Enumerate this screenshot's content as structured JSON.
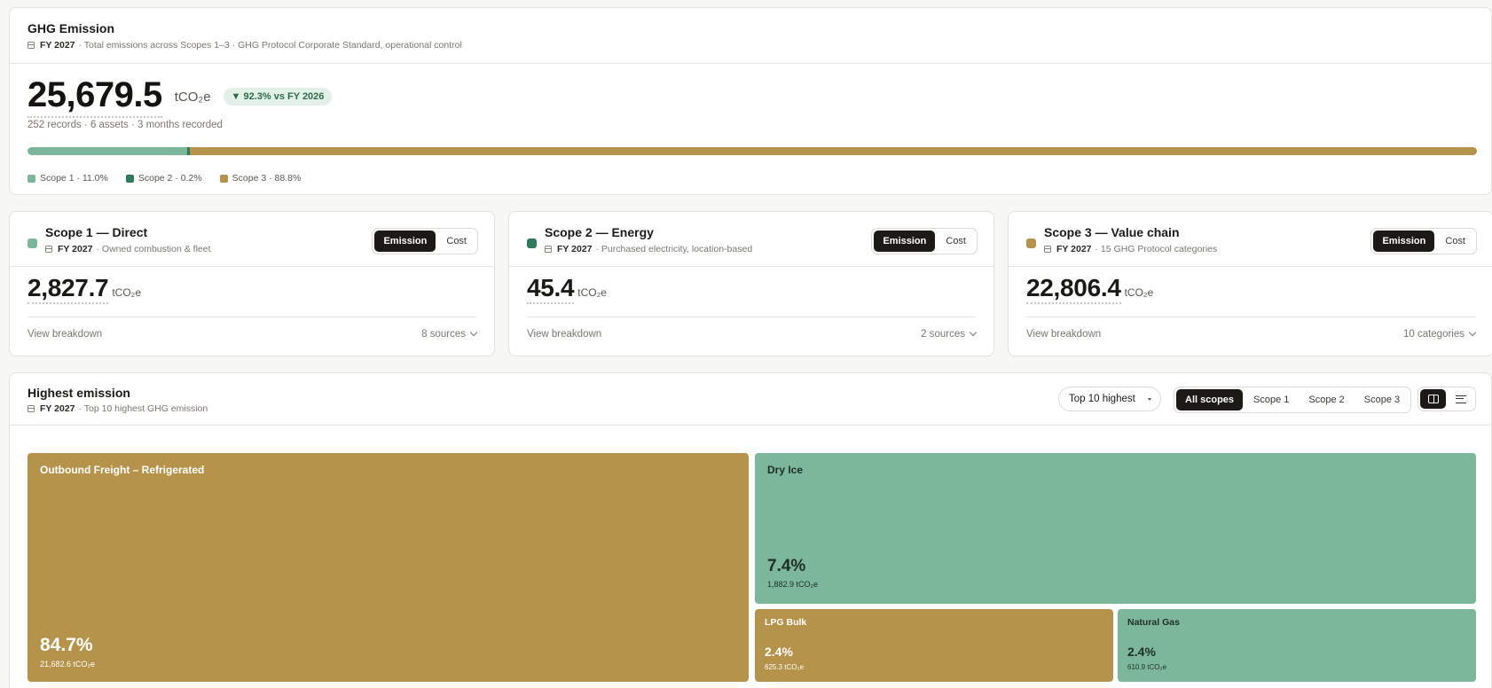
{
  "colors": {
    "scope1": "#7db79b",
    "scope2": "#2f7a5a",
    "scope3": "#b6934a"
  },
  "ghg": {
    "title": "GHG Emission",
    "fy": "FY 2027",
    "description": "· Total emissions across Scopes 1–3 · GHG Protocol Corporate Standard, operational control",
    "total": "25,679.5",
    "unit": "tCO₂e",
    "change_badge": "▼ 92.3% vs FY 2026",
    "summary": "252 records · 6 assets · 3 months recorded",
    "share_pct": [
      11.0,
      0.2,
      88.8
    ],
    "legend": [
      "Scope 1 · 11.0%",
      "Scope 2 · 0.2%",
      "Scope 3 · 88.8%"
    ]
  },
  "scopes": [
    {
      "title": "Scope 1 — Direct",
      "fy": "FY 2027",
      "description": "· Owned combustion & fleet",
      "value": "2,827.7",
      "unit": "tCO₂e",
      "toggle": [
        "Emission",
        "Cost"
      ],
      "breakdown": "View breakdown",
      "count": "8 sources"
    },
    {
      "title": "Scope 2 — Energy",
      "fy": "FY 2027",
      "description": "· Purchased electricity, location-based",
      "value": "45.4",
      "unit": "tCO₂e",
      "toggle": [
        "Emission",
        "Cost"
      ],
      "breakdown": "View breakdown",
      "count": "2 sources"
    },
    {
      "title": "Scope 3 — Value chain",
      "fy": "FY 2027",
      "description": "· 15 GHG Protocol categories",
      "value": "22,806.4",
      "unit": "tCO₂e",
      "toggle": [
        "Emission",
        "Cost"
      ],
      "breakdown": "View breakdown",
      "count": "10 categories"
    }
  ],
  "highest": {
    "title": "Highest emission",
    "fy": "FY 2027",
    "description": "· Top 10 highest GHG emission",
    "dropdown": "Top 10 highest",
    "filters": [
      "All scopes",
      "Scope 1",
      "Scope 2",
      "Scope 3"
    ],
    "view_icons": [
      "treemap-icon",
      "list-icon"
    ],
    "tiles": [
      {
        "name": "Outbound Freight – Refrigerated",
        "pct": "84.7%",
        "value": "21,682.6 tCO₂e",
        "scope": 3
      },
      {
        "name": "Dry Ice",
        "pct": "7.4%",
        "value": "1,882.9 tCO₂e",
        "scope": 1
      },
      {
        "name": "LPG Bulk",
        "pct": "2.4%",
        "value": "625.3 tCO₂e",
        "scope": 3
      },
      {
        "name": "Natural Gas",
        "pct": "2.4%",
        "value": "610.9 tCO₂e",
        "scope": 1
      }
    ]
  }
}
